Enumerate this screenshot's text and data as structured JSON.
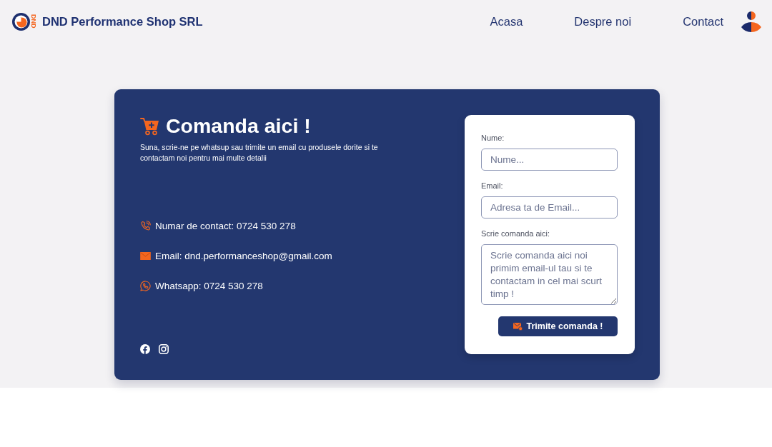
{
  "header": {
    "logo_text": "DND",
    "brand": "DND Performance Shop SRL",
    "nav": [
      "Acasa",
      "Despre noi",
      "Contact"
    ]
  },
  "order_panel": {
    "title": "Comanda aici !",
    "description": "Suna, scrie-ne pe whatsup sau trimite un email cu produsele dorite si te contactam noi pentru mai multe detalii",
    "contacts": [
      {
        "kind": "phone",
        "text": "Numar de contact: 0724 530 278"
      },
      {
        "kind": "email",
        "text": "Email: dnd.performanceshop@gmail.com"
      },
      {
        "kind": "whatsapp",
        "text": "Whatsapp: 0724 530 278"
      }
    ]
  },
  "order_form": {
    "fields": [
      {
        "kind": "input",
        "label": "Nume:",
        "placeholder": "Nume..."
      },
      {
        "kind": "input",
        "label": "Email:",
        "placeholder": "Adresa ta de Email..."
      },
      {
        "kind": "textarea",
        "label": "Scrie comanda aici:",
        "placeholder": "Scrie comanda aici noi primim email-ul tau si te contactam in cel mai scurt timp !"
      }
    ],
    "submit": "Trimite comanda !"
  }
}
